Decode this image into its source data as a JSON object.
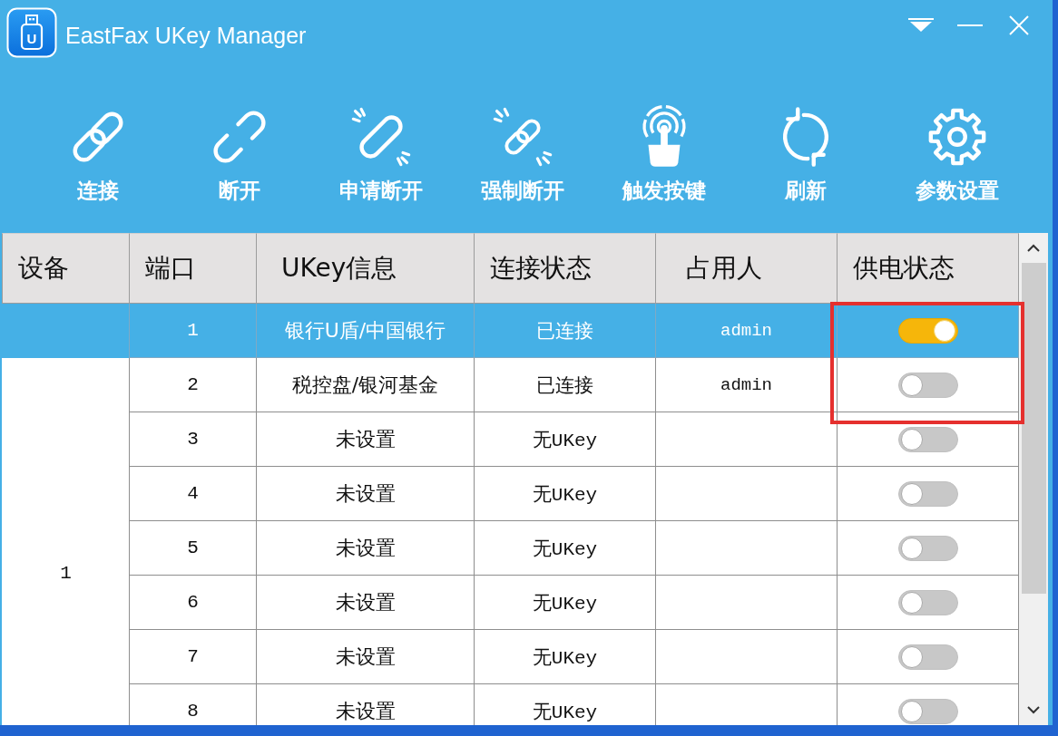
{
  "window": {
    "title": "EastFax UKey Manager",
    "logo_text": "U"
  },
  "toolbar": [
    {
      "kind": "connect",
      "label": "连接"
    },
    {
      "kind": "disconnect",
      "label": "断开"
    },
    {
      "kind": "request_disconnect",
      "label": "申请断开"
    },
    {
      "kind": "force_disconnect",
      "label": "强制断开"
    },
    {
      "kind": "trigger",
      "label": "触发按键"
    },
    {
      "kind": "refresh",
      "label": "刷新"
    },
    {
      "kind": "settings",
      "label": "参数设置"
    }
  ],
  "table": {
    "columns": [
      "设备",
      "端口",
      "UKey信息",
      "连接状态",
      "占用人",
      "供电状态"
    ],
    "device": "1",
    "rows": [
      {
        "port": "1",
        "ukey_info": "银行U盾/中国银行",
        "status": "已连接",
        "user": "admin",
        "power_on": true,
        "highlighted": true,
        "selected": true
      },
      {
        "port": "2",
        "ukey_info": "税控盘/银河基金",
        "status": "已连接",
        "user": "admin",
        "power_on": false,
        "highlighted": true,
        "selected": false
      },
      {
        "port": "3",
        "ukey_info": "未设置",
        "status": "无UKey",
        "power_on": false,
        "highlighted": false,
        "selected": false
      },
      {
        "port": "4",
        "ukey_info": "未设置",
        "status": "无UKey",
        "power_on": false,
        "highlighted": false,
        "selected": false
      },
      {
        "port": "5",
        "ukey_info": "未设置",
        "status": "无UKey",
        "power_on": false,
        "highlighted": false,
        "selected": false
      },
      {
        "port": "6",
        "ukey_info": "未设置",
        "status": "无UKey",
        "power_on": false,
        "highlighted": false,
        "selected": false
      },
      {
        "port": "7",
        "ukey_info": "未设置",
        "status": "无UKey",
        "power_on": false,
        "highlighted": false,
        "selected": false
      },
      {
        "port": "8",
        "ukey_info": "未设置",
        "status": "无UKey",
        "power_on": false,
        "highlighted": false,
        "selected": false
      }
    ]
  }
}
